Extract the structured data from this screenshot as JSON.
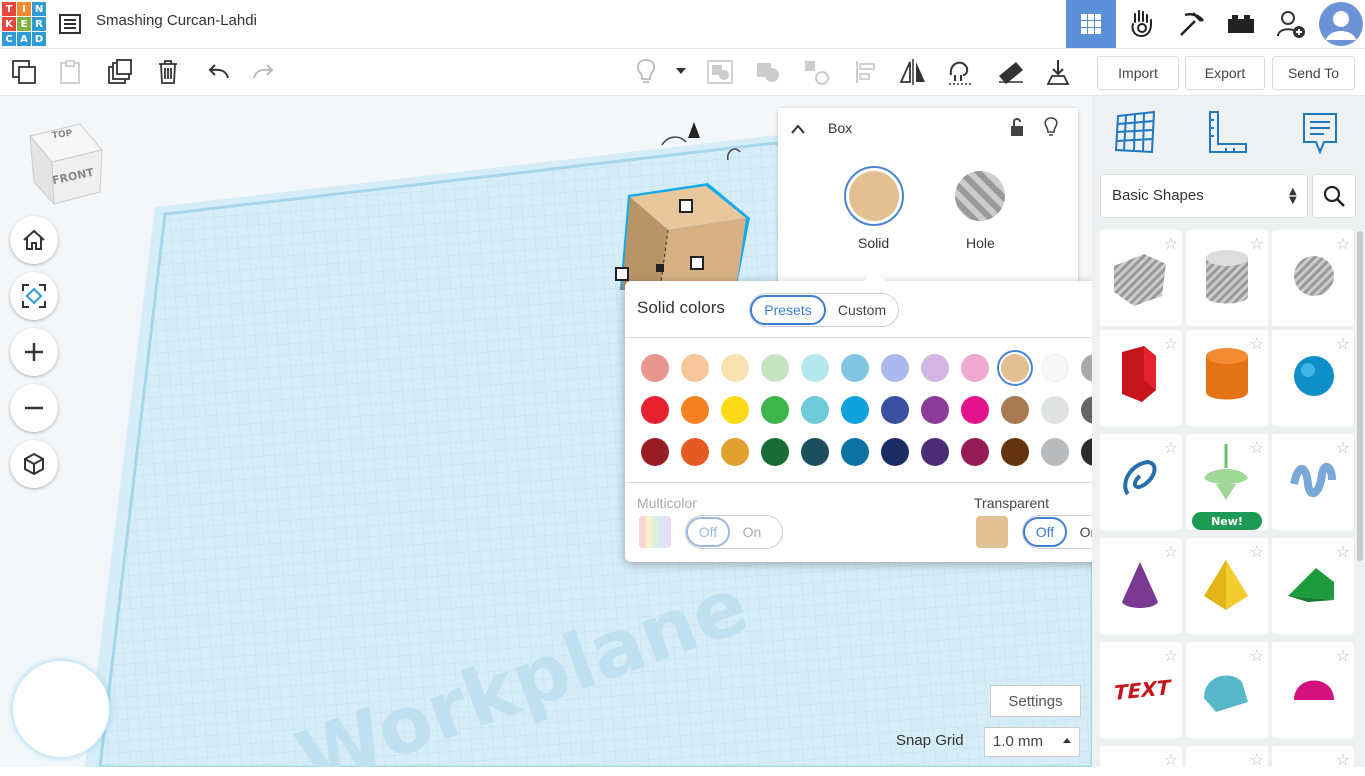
{
  "app": {
    "logo_letters": [
      "T",
      "I",
      "N",
      "K",
      "E",
      "R",
      "C",
      "A",
      "D"
    ],
    "logo_colors": [
      "#e8453c",
      "#f58a34",
      "#2e9bd6",
      "#e8453c",
      "#7cb342",
      "#2e9bd6",
      "#2e9bd6",
      "#2e9bd6",
      "#2e9bd6"
    ],
    "title": "Smashing Curcan-Lahdi"
  },
  "header": {
    "icons": [
      "grid-view-icon",
      "gallery-hand-icon",
      "pickaxe-icon",
      "brick-icon",
      "add-user-icon",
      "user-avatar-icon"
    ]
  },
  "toolbar": {
    "import": "Import",
    "export": "Export",
    "send_to": "Send To"
  },
  "viewcube": {
    "top": "TOP",
    "front": "FRONT"
  },
  "workplane": {
    "label": "Workplane"
  },
  "bottom": {
    "settings": "Settings",
    "snap_label": "Snap Grid",
    "snap_value": "1.0 mm"
  },
  "inspector": {
    "title": "Box",
    "solid": "Solid",
    "hole": "Hole",
    "solid_color": "#e3c092"
  },
  "color_popup": {
    "title": "Solid colors",
    "tab_presets": "Presets",
    "tab_custom": "Custom",
    "swatches": [
      [
        "#e7968e",
        "#f7c69a",
        "#f7e2b2",
        "#c8e3c2",
        "#b5e7ee",
        "#82c7e2",
        "#a9b9ee",
        "#d3b5e3",
        "#eea9d1",
        "#e3c092",
        "#f7f7f7",
        "#a7a9ab"
      ],
      [
        "#e8212f",
        "#f58220",
        "#fdd916",
        "#3db54a",
        "#6ccad9",
        "#10a2dd",
        "#3a51a0",
        "#8b3c98",
        "#e2138c",
        "#a87a53",
        "#dfe1e3",
        "#636567"
      ],
      [
        "#9b1d24",
        "#e45a22",
        "#e1a12f",
        "#186d36",
        "#1b4f5c",
        "#0b73a1",
        "#1b2b63",
        "#4d2d78",
        "#951c57",
        "#653411",
        "#b8bcbf",
        "#2b2c2e"
      ]
    ],
    "selected": "#e3c092",
    "multicolor": "Multicolor",
    "transparent": "Transparent",
    "off": "Off",
    "on": "On"
  },
  "shapes": {
    "category": "Basic Shapes",
    "new_badge": "New!",
    "text_shape": "TEXT"
  }
}
